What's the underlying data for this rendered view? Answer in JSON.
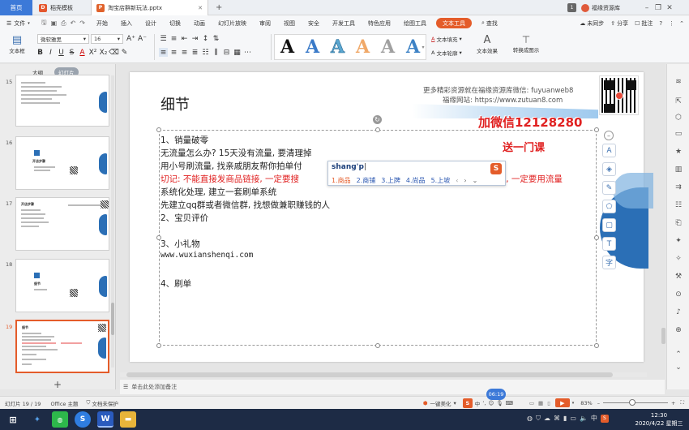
{
  "tabs": {
    "home": "首页",
    "template": "稻壳模板",
    "doc": "淘宝店群新玩法.pptx",
    "add": "+"
  },
  "window": {
    "badge": "1",
    "account": "福缘资源库"
  },
  "menu": {
    "file": "文件",
    "items": [
      "开始",
      "插入",
      "设计",
      "切换",
      "动画",
      "幻灯片放映",
      "审阅",
      "视图",
      "安全",
      "开发工具",
      "特色应用",
      "绘图工具"
    ],
    "active": "文本工具",
    "search": "查找",
    "sync": "未同步",
    "share": "分享",
    "comment": "批注"
  },
  "ribbon": {
    "textbox": "文本框",
    "font": "微软雅黑",
    "size": "16",
    "fill": "文本填充",
    "outline": "文本轮廓",
    "effect": "文本效果",
    "convert": "转换成图示"
  },
  "panel": {
    "tab_outline": "大纲",
    "tab_slides": "幻灯片",
    "add": "+"
  },
  "thumbs": [
    {
      "num": "15",
      "title": ""
    },
    {
      "num": "16",
      "title": "开店步骤"
    },
    {
      "num": "17",
      "title": "开店步骤"
    },
    {
      "num": "18",
      "title": "细节"
    },
    {
      "num": "19",
      "title": "细节"
    }
  ],
  "slide": {
    "title": "细节",
    "promo_line1": "更多精彩资源就在福缘资源库微信: fuyuanweb8",
    "promo_line2": "福缘网站: https://www.zutuan8.com",
    "ad_line1": "加微信12128280",
    "ad_line2": "送一门课",
    "lines": [
      {
        "text": "1、销量破零",
        "red": false
      },
      {
        "text": "无流量怎么办? 15天没有流量, 要清理掉",
        "red": false
      },
      {
        "text": "用小号刷流量, 找亲戚朋友帮你拍单付",
        "red": false
      },
      {
        "text": "切记: 不能直接发商品链接, 一定要搜",
        "red": true
      },
      {
        "text": "系统化处理, 建立一套刷单系统",
        "red": false
      },
      {
        "text": "先建立qq群或者微信群, 找想做兼职赚钱的人",
        "red": false
      },
      {
        "text": "2、宝贝评价",
        "red": false
      },
      {
        "text": "",
        "red": false
      },
      {
        "text": "3、小礼物",
        "red": false
      },
      {
        "text": "www.wuxianshenqi.com",
        "red": false
      },
      {
        "text": "",
        "red": false
      },
      {
        "text": "4、刷单",
        "red": false
      }
    ],
    "red_tail": "!, 一定要用流量"
  },
  "ime": {
    "input": "shang'p",
    "candidates": [
      "1.商品",
      "2.商铺",
      "3.上牌",
      "4.尚品",
      "5.上坡"
    ]
  },
  "notes": "单击此处添加备注",
  "status": {
    "slide_info": "幻灯片 19 / 19",
    "theme": "Office 主题",
    "protect": "文档未保护",
    "beautify": "一键美化",
    "ime_state": "中",
    "timer": "06:19",
    "zoom": "83%"
  },
  "taskbar": {
    "time": "12:30",
    "date": "2020/4/22 星期三",
    "lang": "中"
  },
  "colors": {
    "accent": "#e45c2a",
    "tab_blue": "#3c79d8",
    "red_text": "#e02020",
    "slide_blue": "#2b6fb6"
  }
}
